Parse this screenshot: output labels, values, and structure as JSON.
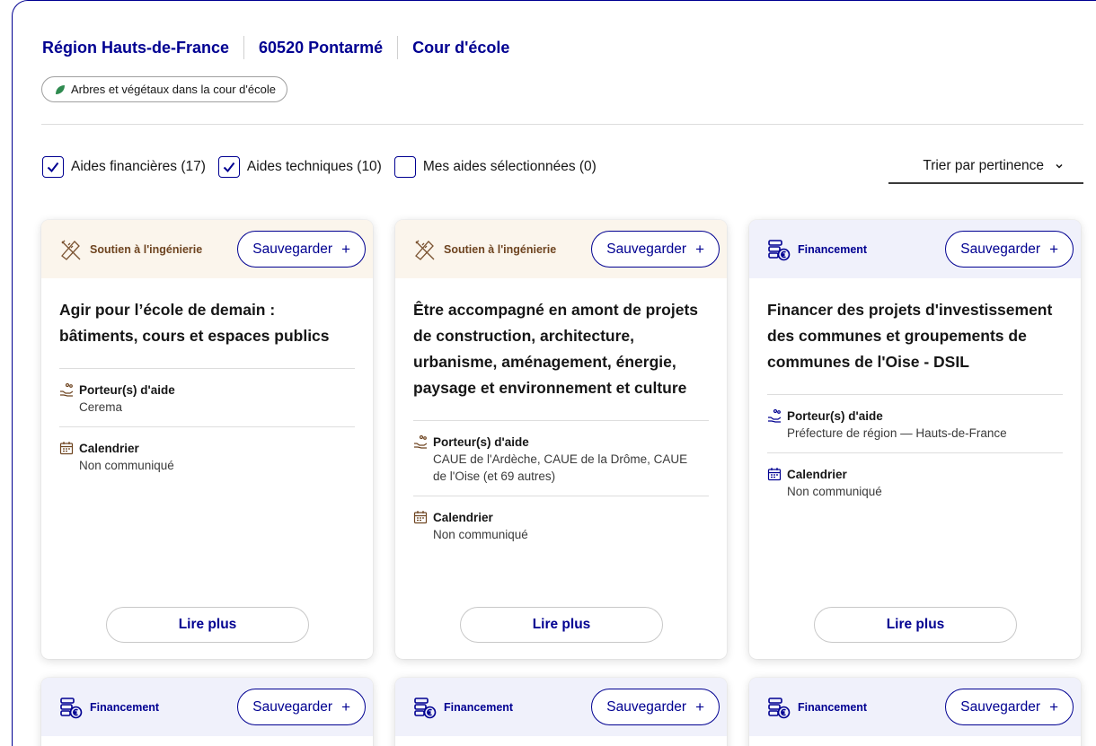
{
  "breadcrumb": [
    "Région Hauts-de-France",
    "60520 Pontarmé",
    "Cour d'école"
  ],
  "tag": {
    "label": "Arbres et végétaux dans la cour d'école",
    "icon": "leaf-icon",
    "color": "#2e8a4f"
  },
  "filters": [
    {
      "label": "Aides financières (17)",
      "checked": true
    },
    {
      "label": "Aides techniques (10)",
      "checked": true
    },
    {
      "label": "Mes aides sélectionnées (0)",
      "checked": false
    }
  ],
  "sort": {
    "label": "Trier par pertinence"
  },
  "colors": {
    "accent": "#000091",
    "ingenierie_bg": "#fbf5ec",
    "financement_bg": "#f0f1fb",
    "ingenierie_text": "#6e4420"
  },
  "labels": {
    "save": "Sauvegarder",
    "save_plus": "+",
    "read_more": "Lire plus",
    "porteur": "Porteur(s) d'aide",
    "calendrier": "Calendrier"
  },
  "cards": [
    {
      "category": "Soutien à l'ingénierie",
      "icon": "drafting-tools-icon",
      "title": "Agir pour l’école de demain : bâtiments, cours et espaces publics",
      "porteur": "Cerema",
      "calendrier": "Non communiqué"
    },
    {
      "category": "Soutien à l'ingénierie",
      "icon": "drafting-tools-icon",
      "title": "Être accompagné en amont de projets de construction, architecture, urbanisme, aménagement, énergie, paysage et environnement et culture",
      "porteur": "CAUE de l'Ardèche, CAUE de la Drôme, CAUE de l'Oise (et 69 autres)",
      "calendrier": "Non communiqué"
    },
    {
      "category": "Financement",
      "icon": "coins-euro-icon",
      "title": "Financer des projets d'investissement des communes et groupements de communes de l'Oise - DSIL",
      "porteur": "Préfecture de région — Hauts-de-France",
      "calendrier": "Non communiqué"
    },
    {
      "category": "Financement",
      "icon": "coins-euro-icon"
    },
    {
      "category": "Financement",
      "icon": "coins-euro-icon"
    },
    {
      "category": "Financement",
      "icon": "coins-euro-icon"
    }
  ]
}
